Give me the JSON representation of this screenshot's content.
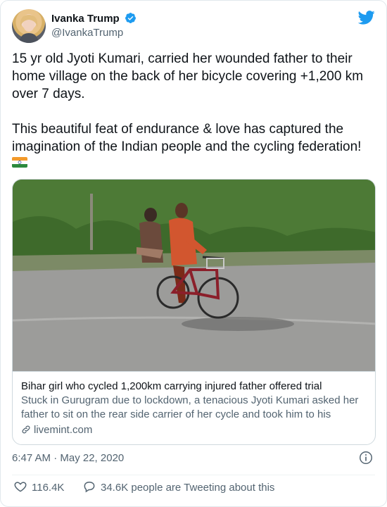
{
  "author": {
    "display_name": "Ivanka Trump",
    "handle": "@IvankaTrump",
    "verified": true
  },
  "tweet": {
    "paragraph_1": "15 yr old Jyoti Kumari, carried her wounded father to their home village on the back of her bicycle covering +1,200 km over 7 days.",
    "paragraph_2": "This beautiful feat of endurance & love has captured the imagination of the Indian people and the cycling federation!",
    "emoji": "indian-flag"
  },
  "card": {
    "title": "Bihar girl who cycled 1,200km carrying injured father offered trial",
    "description": "Stuck in Gurugram due to lockdown, a tenacious Jyoti Kumari asked her father to sit on the rear side carrier of her cycle and took him to his native…",
    "domain": "livemint.com"
  },
  "meta": {
    "timestamp": "6:47 AM · May 22, 2020"
  },
  "actions": {
    "likes": "116.4K",
    "conversation": "34.6K people are Tweeting about this"
  },
  "colors": {
    "twitter_blue": "#1d9bf0",
    "text": "#0f1419",
    "secondary": "#536471",
    "like_red": "#e0245e"
  }
}
